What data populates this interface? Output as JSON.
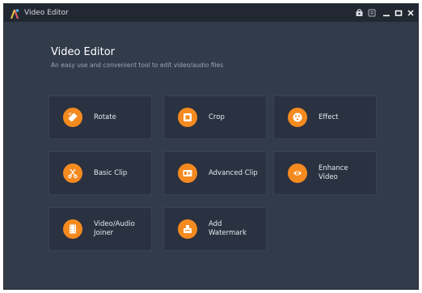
{
  "window": {
    "title": "Video Editor"
  },
  "header": {
    "title": "Video Editor",
    "subtitle": "An easy use and convenient tool to edit video/audio files"
  },
  "tools": [
    {
      "label": "Rotate",
      "icon": "rotate-icon"
    },
    {
      "label": "Crop",
      "icon": "crop-icon"
    },
    {
      "label": "Effect",
      "icon": "effect-icon"
    },
    {
      "label": "Basic Clip",
      "icon": "scissors-icon"
    },
    {
      "label": "Advanced Clip",
      "icon": "advanced-clip-icon"
    },
    {
      "label": "Enhance\nVideo",
      "icon": "enhance-video-icon"
    },
    {
      "label": "Video/Audio\nJoiner",
      "icon": "film-joiner-icon"
    },
    {
      "label": "Add\nWatermark",
      "icon": "watermark-icon"
    }
  ],
  "colors": {
    "accent": "#f58a1f",
    "background": "#323b4a",
    "tile": "#2a3140",
    "titlebar": "#222831"
  }
}
